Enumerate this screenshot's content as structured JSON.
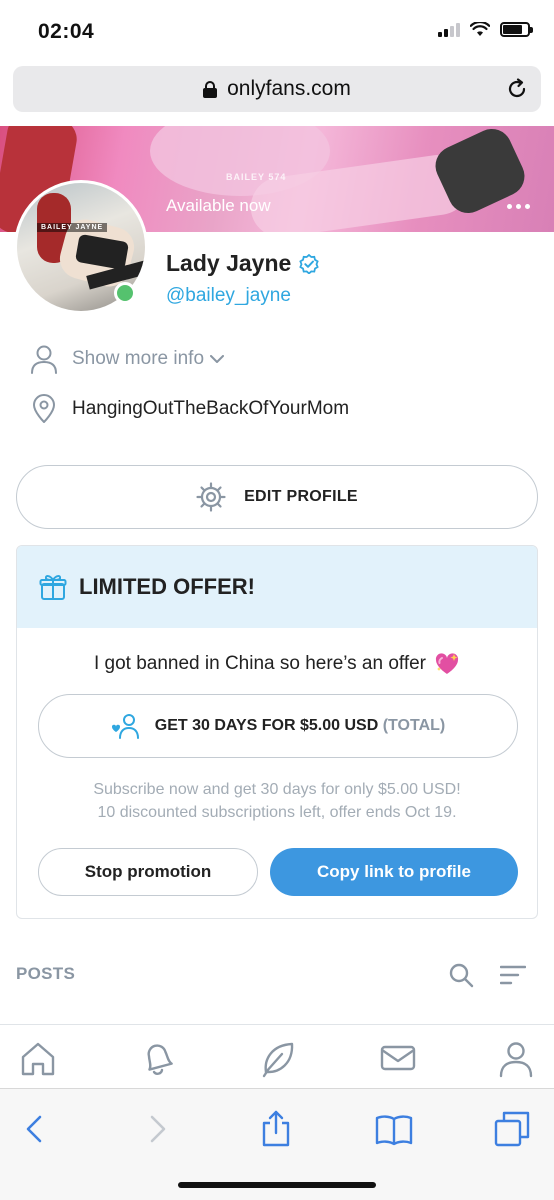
{
  "status_bar": {
    "time": "02:04"
  },
  "browser": {
    "url": "onlyfans.com"
  },
  "banner": {
    "status_text": "Available now",
    "watermark": "BAILEY 574"
  },
  "avatar": {
    "overlay_text": "BAILEY JAYNE"
  },
  "profile": {
    "name": "Lady Jayne",
    "handle": "@bailey_jayne",
    "show_more_label": "Show more info",
    "location": "HangingOutTheBackOfYourMom"
  },
  "edit_profile_label": "EDIT PROFILE",
  "offer": {
    "title": "LIMITED OFFER!",
    "message": "I got banned in China so here’s an offer",
    "cta_label": "GET 30 DAYS FOR $5.00 USD",
    "cta_suffix": "(TOTAL)",
    "note_line1": "Subscribe now and get 30 days for only $5.00 USD!",
    "note_line2": "10 discounted subscriptions left, offer ends Oct 19.",
    "stop_label": "Stop promotion",
    "copy_label": "Copy link to profile"
  },
  "posts": {
    "label": "POSTS"
  },
  "colors": {
    "accent": "#3d97e0",
    "handle": "#2fa7e0",
    "online": "#55c26e",
    "muted": "#8a96a3",
    "offer_header_bg": "#e2f2fb"
  },
  "icons": {
    "app_nav": [
      "home-icon",
      "bell-icon",
      "leaf-icon",
      "messages-icon",
      "profile-icon"
    ],
    "safari": [
      "back-icon",
      "forward-icon",
      "share-icon",
      "bookmarks-icon",
      "tabs-icon"
    ]
  }
}
